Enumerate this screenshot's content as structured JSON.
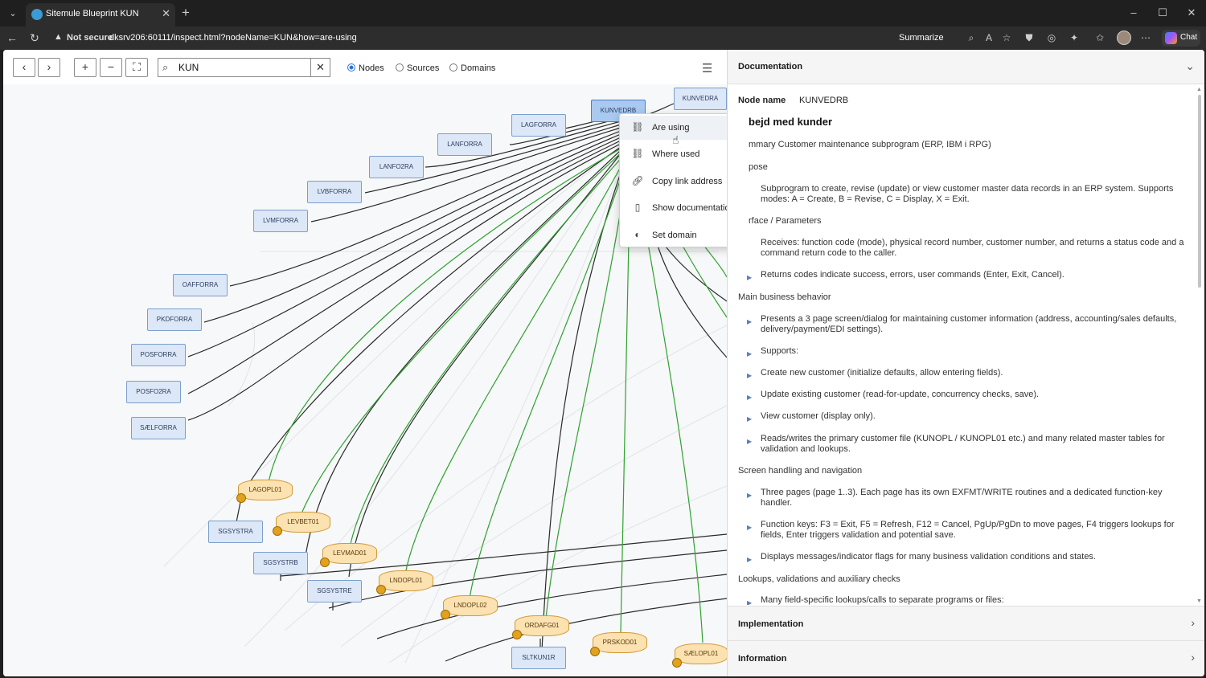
{
  "browser": {
    "tab_title": "Sitemule Blueprint KUN",
    "not_secure": "Not secure",
    "url": "dksrv206:60111/inspect.html?nodeName=KUN&how=are-using",
    "summarize": "Summarize",
    "chat": "Chat"
  },
  "toolbar": {
    "search_value": "KUN",
    "radios": [
      {
        "label": "Nodes",
        "selected": true
      },
      {
        "label": "Sources",
        "selected": false
      },
      {
        "label": "Domains",
        "selected": false
      }
    ]
  },
  "graph": {
    "nodes": [
      "KUNVEDRB",
      "KUNVEDRA",
      "LAGFORRA",
      "LANFORRA",
      "LANFO2RA",
      "LVBFORRA",
      "LVMFORRA",
      "OAFFORRA",
      "PKDFORRA",
      "POSFORRA",
      "POSFO2RA",
      "SÆLFORRA",
      "SGSYSTRA",
      "SGSYSTRB",
      "SGSYSTRE",
      "SLTKUN1R"
    ],
    "db_nodes": [
      "LAGOPL01",
      "LEVBET01",
      "LEVMAD01",
      "LNDOPL01",
      "LNDOPL02",
      "ORDAFG01",
      "PRSKOD01",
      "SÆLOPL01"
    ]
  },
  "context_menu": {
    "items": [
      {
        "label": "Are using",
        "icon": "hierarchy-icon"
      },
      {
        "label": "Where used",
        "icon": "hierarchy-reverse-icon"
      },
      {
        "label": "Copy link address",
        "icon": "link-icon"
      },
      {
        "label": "Show documentation",
        "icon": "document-icon"
      },
      {
        "label": "Set domain",
        "icon": "domain-icon"
      }
    ]
  },
  "documentation": {
    "header": "Documentation",
    "node_label": "Node name",
    "node_value": "KUNVEDRB",
    "title": "bejd med kunder",
    "lines": [
      {
        "text": "mmary Customer maintenance subprogram (ERP, IBM i RPG)",
        "bullet": false
      },
      {
        "text": "pose",
        "bullet": false
      },
      {
        "text": "Subprogram to create, revise (update) or view customer master data records in an ERP system. Supports modes: A = Create, B = Revise, C = Display, X = Exit.",
        "bullet": true
      },
      {
        "text": "rface / Parameters",
        "bullet": false
      },
      {
        "text": "Receives: function code (mode), physical record number, customer number, and returns a status code and a command return code to the caller.",
        "bullet": true
      },
      {
        "text": "Returns codes indicate success, errors, user commands (Enter, Exit, Cancel).",
        "bullet": true
      },
      {
        "text": "Main business behavior",
        "bullet": false
      },
      {
        "text": "Presents a 3 page screen/dialog for maintaining customer information (address, accounting/sales defaults, delivery/payment/EDI settings).",
        "bullet": true
      },
      {
        "text": "Supports:",
        "bullet": true
      },
      {
        "text": "Create new customer (initialize defaults, allow entering fields).",
        "bullet": true
      },
      {
        "text": "Update existing customer (read-for-update, concurrency checks, save).",
        "bullet": true
      },
      {
        "text": "View customer (display only).",
        "bullet": true
      },
      {
        "text": "Reads/writes the primary customer file (KUNOPL / KUNOPL01 etc.) and many related master tables for validation and lookups.",
        "bullet": true
      },
      {
        "text": "Screen handling and navigation",
        "bullet": false
      },
      {
        "text": "Three pages (page 1..3). Each page has its own EXFMT/WRITE routines and a dedicated function-key handler.",
        "bullet": true
      },
      {
        "text": "Function keys: F3 = Exit, F5 = Refresh, F12 = Cancel, PgUp/PgDn to move pages, F4 triggers lookups for fields, Enter triggers validation and potential save.",
        "bullet": true
      },
      {
        "text": "Displays messages/indicator flags for many business validation conditions and states.",
        "bullet": true
      },
      {
        "text": "Lookups, validations and auxiliary checks",
        "bullet": false
      },
      {
        "text": "Many field-specific lookups/calls to separate programs or files:",
        "bullet": true
      }
    ],
    "implementation": "Implementation",
    "information": "Information"
  }
}
